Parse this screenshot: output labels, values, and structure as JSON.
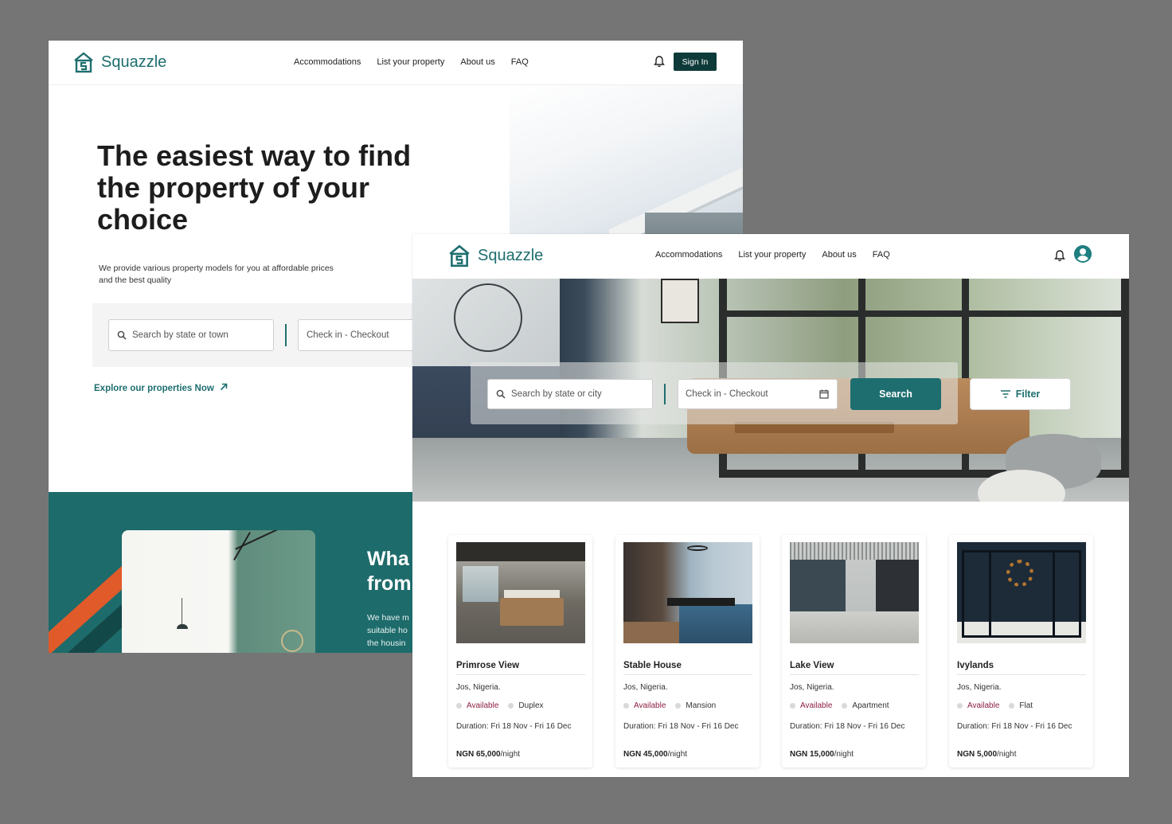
{
  "brand": {
    "name": "Squazzle",
    "color": "#1e6e6f"
  },
  "nav": [
    "Accommodations",
    "List your property",
    "About us",
    "FAQ"
  ],
  "landing": {
    "sign_in": "Sign In",
    "headline": "The easiest way to find the property of your choice",
    "subtext": "We provide various property models for you at affordable prices and the best quality",
    "search_placeholder": "Search by state or town",
    "date_placeholder": "Check in - Checkout",
    "explore_link": "Explore our properties Now",
    "section_heading": "Wha\nfrom",
    "section_text": "We have m\nsuitable ho\nthe housin"
  },
  "listings": {
    "search_placeholder": "Search by state or city",
    "date_placeholder": "Check in - Checkout",
    "search_button": "Search",
    "filter_button": "Filter",
    "cards": [
      {
        "name": "Primrose View",
        "location": "Jos, Nigeria.",
        "status": "Available",
        "type": "Duplex",
        "duration": "Duration: Fri 18 Nov - Fri 16 Dec",
        "price": "NGN 65,000",
        "unit": "/night"
      },
      {
        "name": "Stable House",
        "location": "Jos, Nigeria.",
        "status": "Available",
        "type": "Mansion",
        "duration": "Duration: Fri 18 Nov - Fri 16 Dec",
        "price": "NGN 45,000",
        "unit": "/night"
      },
      {
        "name": "Lake View",
        "location": "Jos, Nigeria.",
        "status": "Available",
        "type": "Apartment",
        "duration": "Duration: Fri 18 Nov - Fri 16 Dec",
        "price": "NGN 15,000",
        "unit": "/night"
      },
      {
        "name": "Ivylands",
        "location": "Jos, Nigeria.",
        "status": "Available",
        "type": "Flat",
        "duration": "Duration: Fri 18 Nov - Fri 16 Dec",
        "price": "NGN 5,000",
        "unit": "/night"
      }
    ]
  },
  "icons": [
    "house-logo-icon",
    "bell-icon",
    "search-icon",
    "calendar-icon",
    "filter-icon",
    "arrow-up-right-icon",
    "user-avatar-icon"
  ],
  "colors": {
    "primary": "#1e6e6f",
    "dark_button": "#0f3a3a",
    "available": "#8c1f3f",
    "accent_stripe": "#e05a2a",
    "backdrop": "#757575"
  }
}
